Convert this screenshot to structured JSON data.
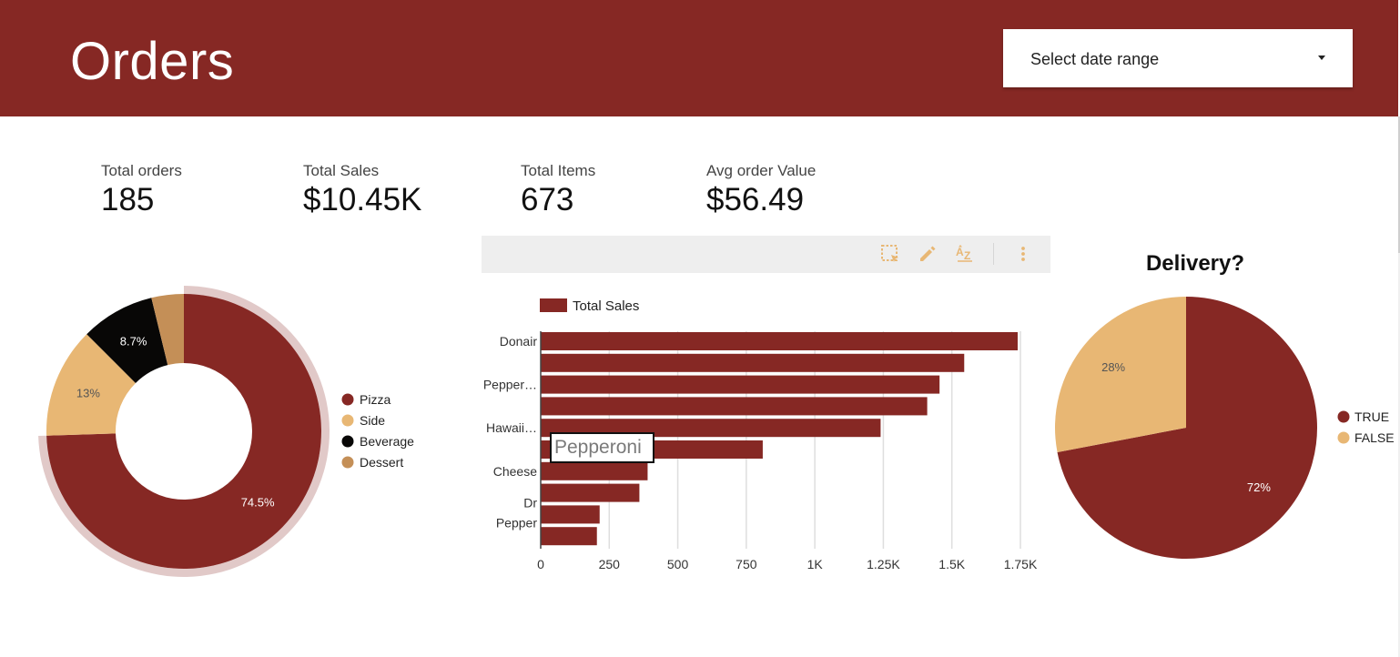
{
  "header": {
    "title": "Orders",
    "date_range": {
      "label": "Select date range"
    }
  },
  "kpis": [
    {
      "label": "Total orders",
      "value": "185"
    },
    {
      "label": "Total Sales",
      "value": "$10.45K"
    },
    {
      "label": "Total Items",
      "value": "673"
    },
    {
      "label": "Avg order Value",
      "value": "$56.49"
    }
  ],
  "toolbar": {
    "icons": [
      "select-region-icon",
      "edit-pencil-icon",
      "sort-az-icon",
      "more-vert-icon"
    ]
  },
  "colors": {
    "brand": "#862824",
    "side": "#e8b774",
    "beverage": "#080706",
    "dessert": "#c48f57",
    "axis_label": "#333333",
    "grid": "#dedede"
  },
  "tooltip": {
    "text": "Pepperoni"
  },
  "chart_data": [
    {
      "type": "pie",
      "variant": "donut",
      "title": "",
      "categories": [
        "Pizza",
        "Side",
        "Beverage",
        "Dessert"
      ],
      "values": [
        74.5,
        13,
        8.7,
        3.8
      ],
      "labels": [
        "74.5%",
        "13%",
        "8.7%",
        ""
      ],
      "colors": [
        "#862824",
        "#e8b774",
        "#080706",
        "#c48f57"
      ],
      "highlighted": "Pizza",
      "legend": "right"
    },
    {
      "type": "bar",
      "orientation": "horizontal",
      "title": "",
      "legend": [
        "Total Sales"
      ],
      "categories": [
        "Donair",
        "",
        "Pepper…",
        "",
        "Hawaii…",
        "",
        "Cheese",
        "",
        "Dr Pepper",
        ""
      ],
      "series": [
        {
          "name": "Total Sales",
          "values": [
            1740,
            1545,
            1455,
            1410,
            1240,
            810,
            390,
            360,
            215,
            205
          ]
        }
      ],
      "xticks": [
        "0",
        "250",
        "500",
        "750",
        "1K",
        "1.25K",
        "1.5K",
        "1.75K"
      ],
      "xlim": [
        0,
        1750
      ],
      "grid": true
    },
    {
      "type": "pie",
      "title": "Delivery?",
      "categories": [
        "TRUE",
        "FALSE"
      ],
      "values": [
        72,
        28
      ],
      "labels": [
        "72%",
        "28%"
      ],
      "colors": [
        "#862824",
        "#e8b774"
      ],
      "legend": "right"
    }
  ]
}
